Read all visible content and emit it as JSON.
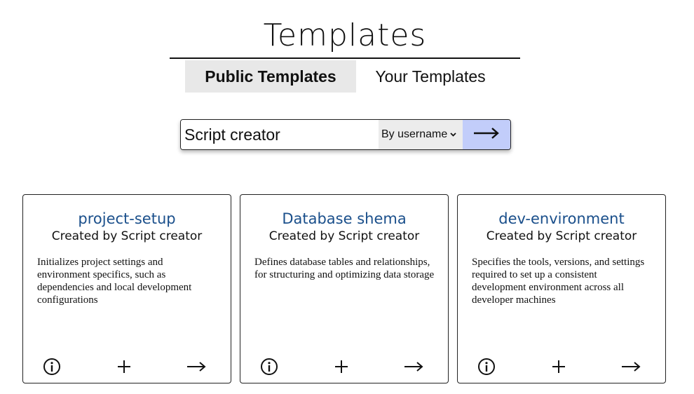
{
  "header": {
    "title": "Templates"
  },
  "tabs": [
    {
      "label": "Public Templates",
      "active": true
    },
    {
      "label": "Your Templates",
      "active": false
    }
  ],
  "search": {
    "value": "Script creator",
    "filter_selected": "By username",
    "submit_icon": "arrow-right-icon"
  },
  "templates": [
    {
      "name": "project-setup",
      "author": "Created by Script creator",
      "description": "Initializes project settings and environment specifics, such as dependencies and local development configurations"
    },
    {
      "name": "Database shema",
      "author": "Created by Script creator",
      "description": "Defines database tables and relationships, for structuring and optimizing data storage"
    },
    {
      "name": "dev-environment",
      "author": "Created by Script creator",
      "description": "Specifies the tools, versions, and settings required to set up a consistent development environment across all developer machines"
    }
  ],
  "card_actions": {
    "info_icon": "info-icon",
    "add_icon": "plus-icon",
    "open_icon": "arrow-right-icon"
  },
  "colors": {
    "accent_submit": "#c2cdfa",
    "card_title": "#1a4f8b",
    "tab_active_bg": "#e8e8e8"
  }
}
